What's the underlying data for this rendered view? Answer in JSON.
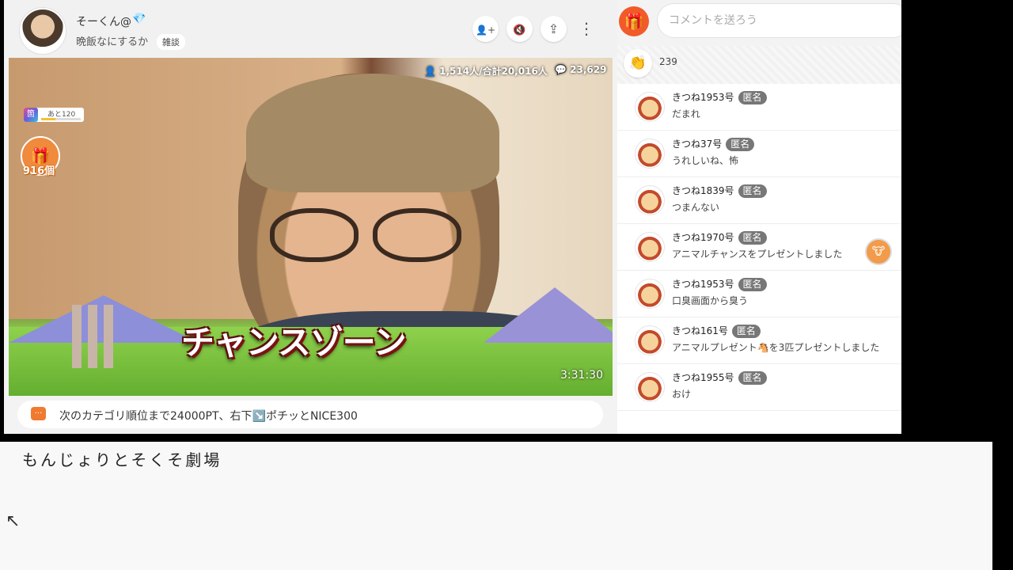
{
  "header": {
    "streamer_name": "そーくん@",
    "diamond_icon": "💎",
    "stream_title": "晩飯なにするか",
    "category": "雑談",
    "follow_icon": "👤+",
    "mute_icon": "🔇",
    "share_icon": "⇪",
    "more_icon": "⋮"
  },
  "video": {
    "viewer_stats": "1,514人/合計20,016人",
    "comment_count": "23,629",
    "overlay_text": "チャンスゾーン",
    "timer": "3:31:30",
    "rank_badge_icon": "箇",
    "rank_badge_text": "あと120",
    "rank_progress": 0.35,
    "gift_icon": "🎁",
    "gift_count": "916個"
  },
  "notice": {
    "icon": "💬",
    "text": "次のカテゴリ順位まで24000PT、右下↘️ポチッとNICE300"
  },
  "comment_panel": {
    "gift_icon": "🎁",
    "input_placeholder": "コメントを送ろう",
    "clap_icon": "👏",
    "clap_count": "239",
    "anon_badge": "匿名",
    "comments": [
      {
        "name": "きつね1953号",
        "text": "だまれ"
      },
      {
        "name": "きつね37号",
        "text": "うれしいね、怖"
      },
      {
        "name": "きつね1839号",
        "text": "つまんない"
      },
      {
        "name": "きつね1970号",
        "text": "アニマルチャンスをプレゼントしました",
        "extra_icon": "🐮"
      },
      {
        "name": "きつね1953号",
        "text": "口臭画面から臭う"
      },
      {
        "name": "きつね161号",
        "text": "アニマルプレゼント🐴を3匹プレゼントしました"
      },
      {
        "name": "きつね1955号",
        "text": "おけ"
      }
    ]
  },
  "notepad": {
    "text": "もんじょりとそくそ劇場",
    "cursor_icon": "↖"
  }
}
